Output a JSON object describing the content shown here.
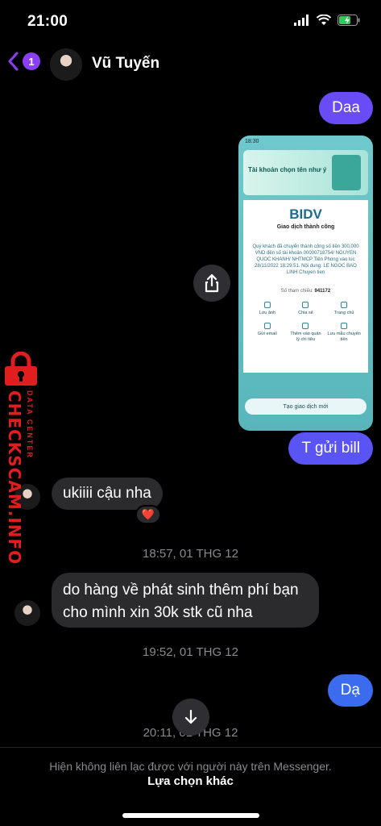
{
  "status_bar": {
    "time": "21:00"
  },
  "header": {
    "back_count": "1",
    "contact_name": "Vũ Tuyến"
  },
  "messages": {
    "out_1": "Daa",
    "out_2": "T gửi bill",
    "in_1": "ukiiii cậu nha",
    "in_1_reaction": "❤️",
    "in_2": "do hàng về phát sinh thêm phí bạn cho mình xin 30k stk cũ nha",
    "out_3": "Dạ"
  },
  "timestamps": {
    "t1": "18:57, 01 THG 12",
    "t2": "19:52, 01 THG 12",
    "t3": "20:11, 01 THG 12"
  },
  "attachment": {
    "status_time": "18:30",
    "banner_title": "Tài khoản chọn tên như ý",
    "bank": "BIDV",
    "result": "Giao dịch thành công",
    "description": "Quý khách đã chuyển thành công số tiền 300,000 VND đến số tài khoản 00000718754/ NGUYEN QUOC KHANH/ NHTMCP Tiên Phong vào lúc 28/11/2022 18:29:51. Nội dung: LE NGOC BAO LINH Chuyen tien",
    "ref_label": "Số tham chiếu:",
    "ref_value": "941172",
    "actions": [
      "Lưu ảnh",
      "Chia sẻ",
      "Trang chủ",
      "Gửi email",
      "Thêm vào quản lý chi tiêu",
      "Lưu mẫu chuyển tiền"
    ],
    "new_tx": "Tạo giao dịch mới"
  },
  "footer": {
    "notice": "Hiện không liên lạc được với người này trên Messenger.",
    "link": "Lựa chọn khác"
  },
  "watermark": {
    "main": "CHECKSCAM.INFO",
    "sub": "DATA CENTER"
  },
  "colors": {
    "accent": "#8b3ff5",
    "bubble_out": "#6a4cf7",
    "bubble_in": "#2b2b2e",
    "watermark": "#e01e1e"
  }
}
